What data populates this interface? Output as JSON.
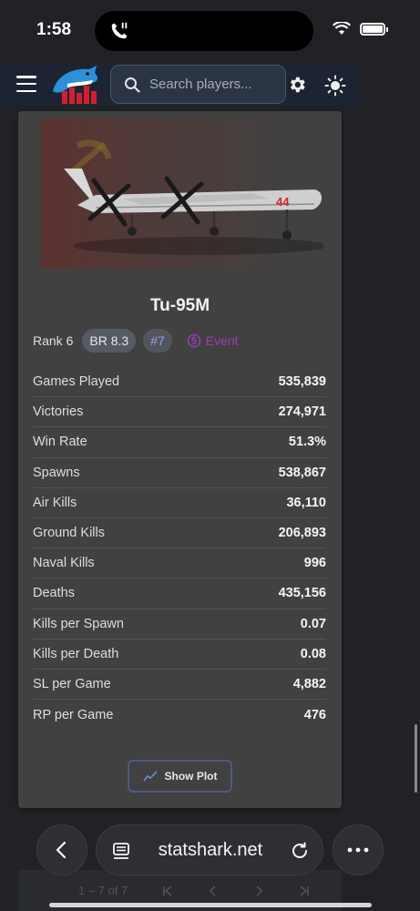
{
  "status_bar": {
    "time": "1:58"
  },
  "header": {
    "search_placeholder": "Search players...",
    "icons": [
      "menu-icon",
      "logo",
      "search-icon",
      "gear-icon",
      "sun-icon"
    ]
  },
  "vehicle": {
    "name": "Tu-95M",
    "rank": "Rank 6",
    "br": "BR 8.3",
    "position": "#7",
    "event_label": "Event",
    "event_color": "#9b3bb7",
    "plane_tail_number": "44"
  },
  "stats": [
    {
      "label": "Games Played",
      "value": "535,839"
    },
    {
      "label": "Victories",
      "value": "274,971"
    },
    {
      "label": "Win Rate",
      "value": "51.3%"
    },
    {
      "label": "Spawns",
      "value": "538,867"
    },
    {
      "label": "Air Kills",
      "value": "36,110"
    },
    {
      "label": "Ground Kills",
      "value": "206,893"
    },
    {
      "label": "Naval Kills",
      "value": "996"
    },
    {
      "label": "Deaths",
      "value": "435,156"
    },
    {
      "label": "Kills per Spawn",
      "value": "0.07"
    },
    {
      "label": "Kills per Death",
      "value": "0.08"
    },
    {
      "label": "SL per Game",
      "value": "4,882"
    },
    {
      "label": "RP per Game",
      "value": "476"
    }
  ],
  "actions": {
    "show_plot": "Show Plot"
  },
  "pager": {
    "range": "1 – 7 of 7"
  },
  "browser": {
    "url": "statshark.net"
  }
}
